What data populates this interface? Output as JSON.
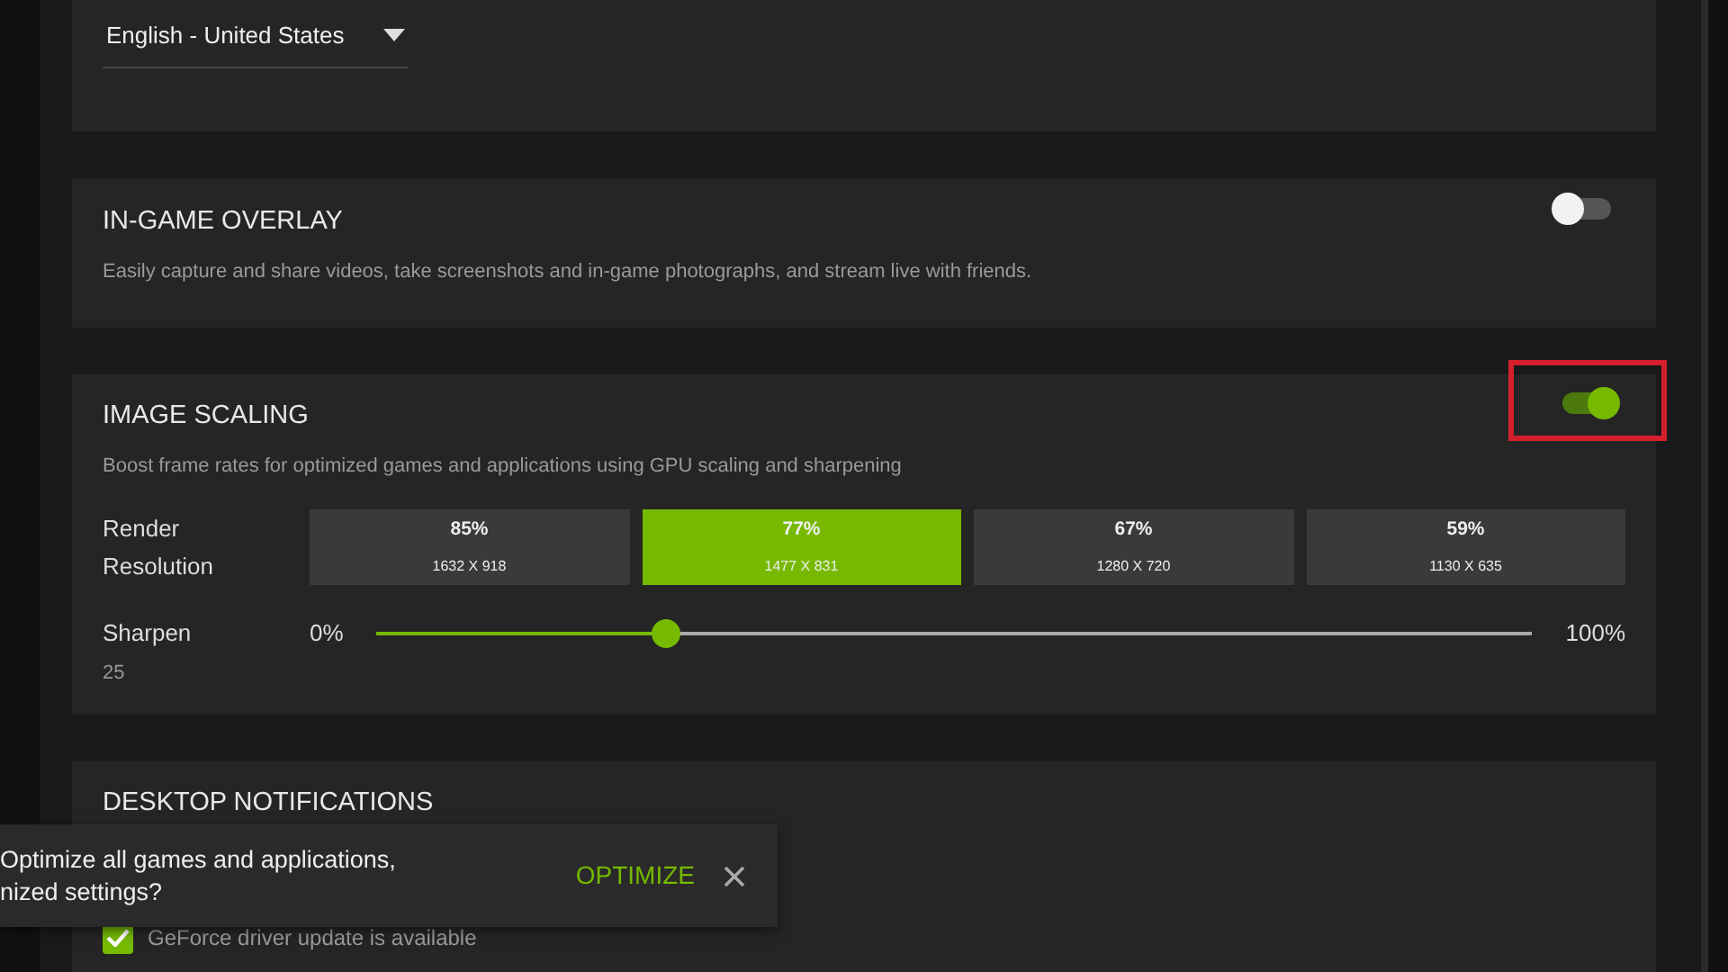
{
  "language_select": {
    "value": "English - United States"
  },
  "sections": [
    {
      "kind": "toggle",
      "title": "IN-GAME OVERLAY",
      "description": "Easily capture and share videos, take screenshots and in-game photographs, and stream live with friends.",
      "on": false
    },
    {
      "kind": "scaling",
      "title": "IMAGE SCALING",
      "description": "Boost frame rates for optimized games and applications using GPU scaling and sharpening",
      "on": true,
      "highlighted": true,
      "resolution_label": "Render Resolution",
      "resolutions": [
        {
          "percent": "85%",
          "size": "1632 X 918",
          "selected": false
        },
        {
          "percent": "77%",
          "size": "1477 X 831",
          "selected": true
        },
        {
          "percent": "67%",
          "size": "1280 X 720",
          "selected": false
        },
        {
          "percent": "59%",
          "size": "1130 X 635",
          "selected": false
        }
      ],
      "sharpen": {
        "label": "Sharpen",
        "value": "25",
        "min_label": "0%",
        "max_label": "100%",
        "level": 0.25
      }
    },
    {
      "kind": "notifications",
      "title": "DESKTOP NOTIFICATIONS",
      "items": [
        {
          "label": "GeForce driver update is available",
          "checked": true
        }
      ]
    }
  ],
  "toast": {
    "message": "Optimize all games and applications,\nnized settings?",
    "action": "OPTIMIZE"
  }
}
